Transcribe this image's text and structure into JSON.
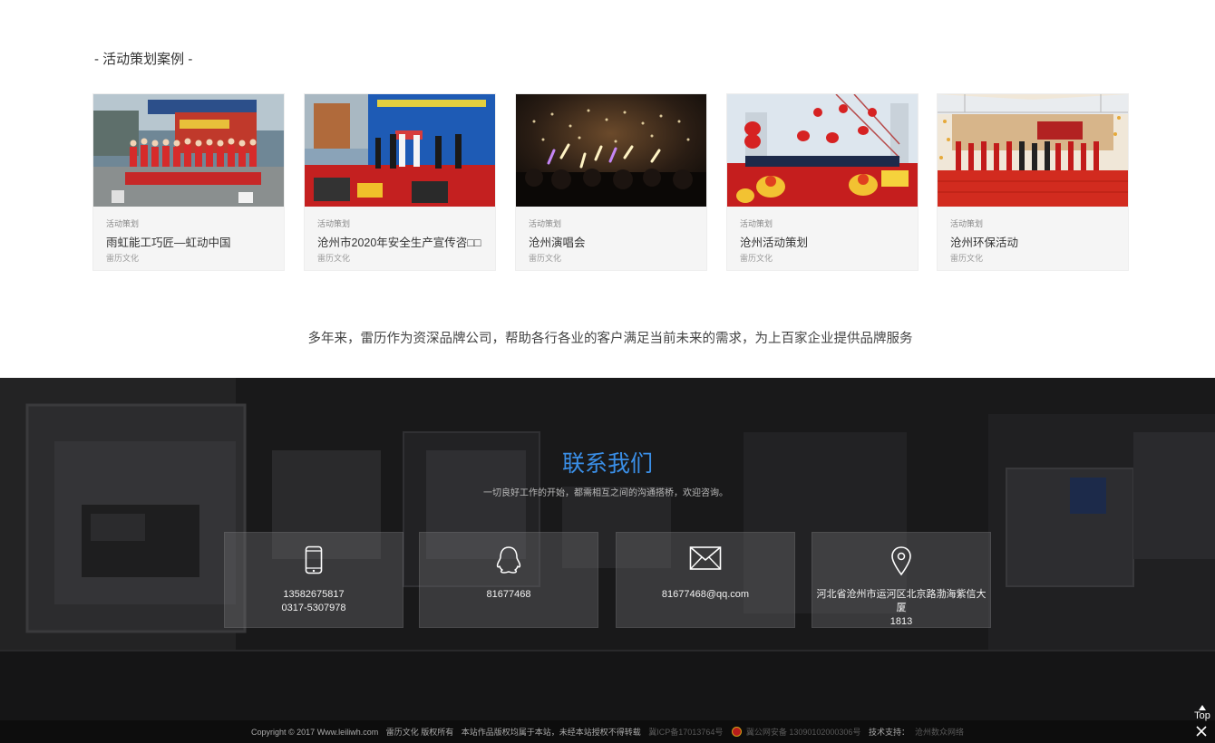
{
  "cases_section": {
    "title": "- 活动策划案例 -",
    "cards": [
      {
        "category": "活动策划",
        "name": "雨虹能工巧匠—虹动中国",
        "author": "雷历文化"
      },
      {
        "category": "活动策划",
        "name": "沧州市2020年安全生产宣传咨□□",
        "author": "雷历文化"
      },
      {
        "category": "活动策划",
        "name": "沧州演唱会",
        "author": "雷历文化"
      },
      {
        "category": "活动策划",
        "name": "沧州活动策划",
        "author": "雷历文化"
      },
      {
        "category": "活动策划",
        "name": "沧州环保活动",
        "author": "雷历文化"
      }
    ]
  },
  "slogan": "多年来，雷历作为资深品牌公司，帮助各行各业的客户满足当前未来的需求，为上百家企业提供品牌服务",
  "contact": {
    "title": "联系我们",
    "subtitle": "一切良好工作的开始，都需相互之间的沟通搭桥，欢迎咨询。",
    "boxes": [
      {
        "icon": "mobile-phone-icon",
        "line1": "13582675817",
        "line2": "0317-5307978"
      },
      {
        "icon": "qq-icon",
        "line1": "81677468",
        "line2": ""
      },
      {
        "icon": "envelope-icon",
        "line1": "81677468@qq.com",
        "line2": ""
      },
      {
        "icon": "location-pin-icon",
        "line1": "河北省沧州市运河区北京路渤海紫信大厦",
        "line2": "1813"
      }
    ]
  },
  "footer": {
    "copyright": "Copyright © 2017 Www.leiliwh.com",
    "company": "雷历文化 版权所有",
    "notice": "本站作品版权均属于本站，未经本站授权不得转载",
    "icp": "冀ICP备17013764号",
    "police": "冀公网安备 13090102000306号",
    "support_label": "技术支持：",
    "support_value": "沧州数众网络"
  },
  "float": {
    "top_label": "Top"
  },
  "colors": {
    "accent": "#3a8ee6",
    "footer_bg": "#0d0d0d",
    "contact_bg": "#1b1b1c"
  }
}
